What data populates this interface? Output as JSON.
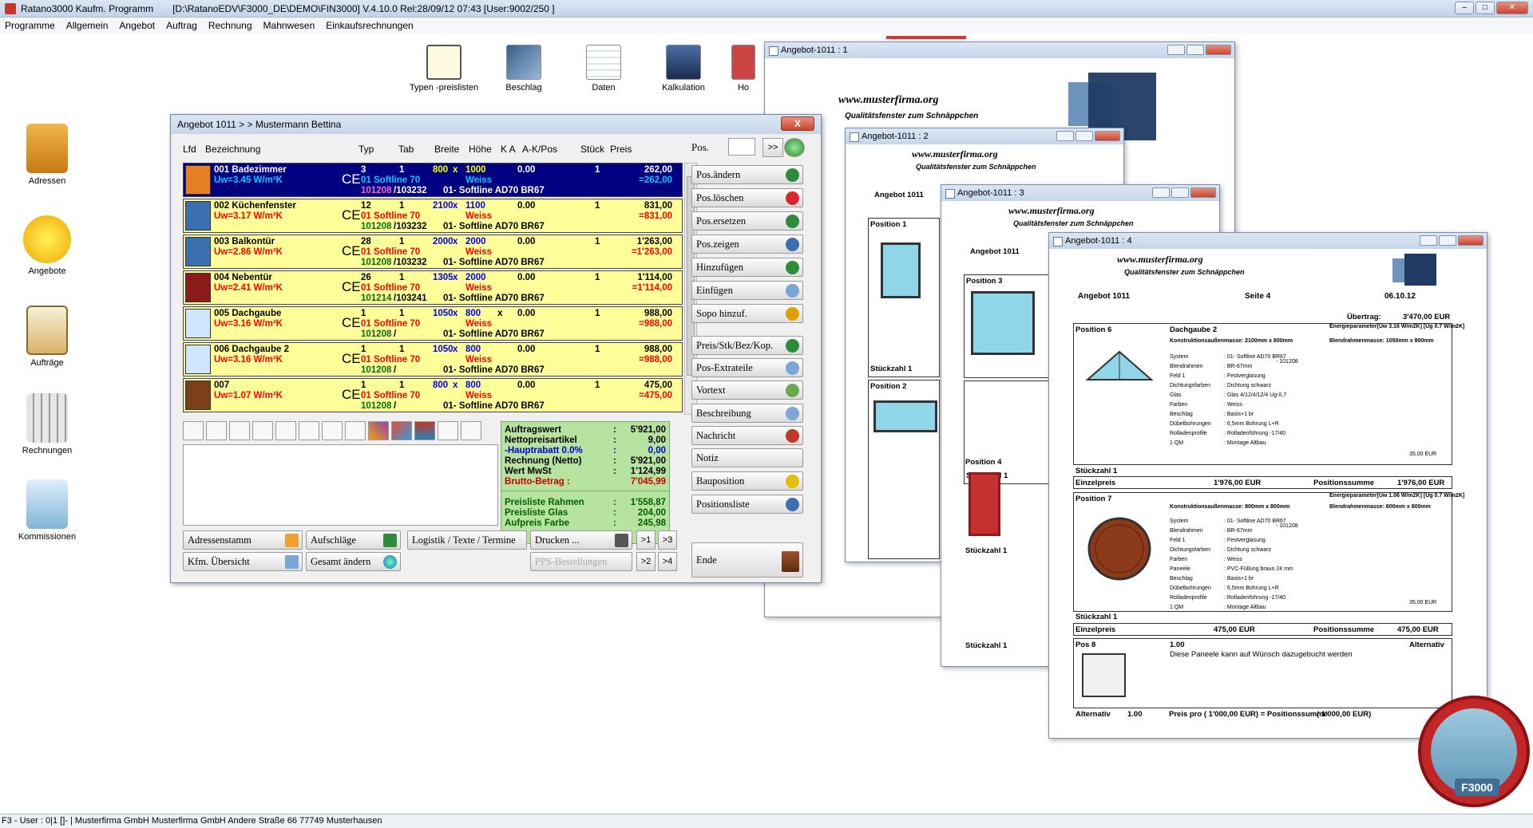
{
  "app": {
    "title": "Ratano3000 Kaufm. Programm",
    "path": "[D:\\RatanoEDV\\F3000_DE\\DEMO\\FIN3000] V.4.10.0 Rel:28/09/12 07:43 [User:9002/250 ]",
    "win_min": "–",
    "win_max": "□",
    "win_close": "✕"
  },
  "menu": [
    "Programme",
    "Allgemein",
    "Angebot",
    "Auftrag",
    "Rechnung",
    "Mahnwesen",
    "Einkaufsrechnungen"
  ],
  "toolbar": [
    "Typen -preislisten",
    "Beschlag",
    "Daten",
    "Kalkulation",
    "Ho"
  ],
  "sidebar": [
    "Adressen",
    "Angebote",
    "Aufträge",
    "Rechnungen",
    "Kommissionen"
  ],
  "dialog": {
    "title": "Angebot 1011 >  > Mustermann Bettina",
    "close": "X",
    "headers": {
      "lfd": "Lfd",
      "bez": "Bezeichnung",
      "typ": "Typ",
      "tab": "Tab",
      "breite": "Breite",
      "hoehe": "Höhe",
      "ka": "K A",
      "akpos": "A-K/Pos",
      "stueck": "Stück",
      "preis": "Preis"
    },
    "pos_label": "Pos.",
    "pos_nav": ">>",
    "rows": [
      {
        "name": "001 Badezimmer",
        "uw": "Uw=3.45 W/m²K",
        "typ": "3",
        "tab": "1",
        "b": "800",
        "x": "x",
        "h": "1000",
        "ak": "0.00",
        "st": "1",
        "p1": "262,00",
        "p2": "=262,00",
        "typname": "01 Softline 70",
        "farbe": "Weiss",
        "code": "101208",
        "code2": "/103232",
        "profil": "01- Softline AD70 BR67",
        "ce": "CE"
      },
      {
        "name": "002 Küchenfenster",
        "uw": "Uw=3.17 W/m²K",
        "typ": "12",
        "tab": "1",
        "b": "2100",
        "x": "x",
        "h": "1100",
        "ak": "0.00",
        "st": "1",
        "p1": "831,00",
        "p2": "=831,00",
        "typname": "01 Softline 70",
        "farbe": "Weiss",
        "code": "101208",
        "code2": "/103232",
        "profil": "01- Softline AD70 BR67",
        "ce": "CE"
      },
      {
        "name": "003 Balkontür",
        "uw": "Uw=2.86 W/m²K",
        "typ": "28",
        "tab": "1",
        "b": "2000",
        "x": "x",
        "h": "2000",
        "ak": "0.00",
        "st": "1",
        "p1": "1'263,00",
        "p2": "=1'263,00",
        "typname": "01 Softline 70",
        "farbe": "Weiss",
        "code": "101208",
        "code2": "/103232",
        "profil": "01- Softline AD70 BR67",
        "ce": "CE"
      },
      {
        "name": "004 Nebentür",
        "uw": "Uw=2.41 W/m²K",
        "typ": "26",
        "tab": "1",
        "b": "1305",
        "x": "x",
        "h": "2000",
        "ak": "0.00",
        "st": "1",
        "p1": "1'114,00",
        "p2": "=1'114,00",
        "typname": "01 Softline 70",
        "farbe": "Weiss",
        "code": "101214",
        "code2": "/103241",
        "profil": "01- Softline AD70 BR67",
        "ce": "CE"
      },
      {
        "name": "005 Dachgaube",
        "uw": "Uw=3.16 W/m²K",
        "typ": "1",
        "tab": "1",
        "b": "1050",
        "x": "x",
        "h": "800",
        "ak": "0.00",
        "st": "1",
        "p1": "988,00",
        "p2": "=988,00",
        "typname": "01 Softline 70",
        "farbe": "Weiss",
        "code": "101208",
        "code2": "/",
        "profil": "01- Softline AD70 BR67",
        "ce": "CE",
        "xmark": "x"
      },
      {
        "name": "006 Dachgaube 2",
        "uw": "Uw=3.16 W/m²K",
        "typ": "1",
        "tab": "1",
        "b": "1050",
        "x": "x",
        "h": "800",
        "ak": "0.00",
        "st": "1",
        "p1": "988,00",
        "p2": "=988,00",
        "typname": "01 Softline 70",
        "farbe": "Weiss",
        "code": "101208",
        "code2": "/",
        "profil": "01- Softline AD70 BR67",
        "ce": "CE"
      },
      {
        "name": "007",
        "uw": "Uw=1.07 W/m²K",
        "typ": "1",
        "tab": "1",
        "b": "800",
        "x": "x",
        "h": "800",
        "ak": "0.00",
        "st": "1",
        "p1": "475,00",
        "p2": "=475,00",
        "typname": "01 Softline 70",
        "farbe": "Weiss",
        "code": "101208",
        "code2": "/",
        "profil": "01- Softline AD70 BR67",
        "ce": "CE"
      }
    ],
    "right_buttons": [
      "Pos.ändern",
      "Pos.löschen",
      "Pos.ersetzen",
      "Pos.zeigen",
      "Hinzufügen",
      "Einfügen",
      "Sopo hinzuf.",
      "Preis/Stk/Bez/Kop.",
      "Pos-Extrateile",
      "Vortext",
      "Beschreibung",
      "Nachricht",
      "Notiz",
      "Bauposition",
      "Positionsliste"
    ],
    "ende": "Ende",
    "summary": [
      {
        "l": "Auftragswert",
        "c": ":",
        "v": "5'921,00",
        "color": "#000000"
      },
      {
        "l": "Nettopreisartikel",
        "c": ":",
        "v": "9,00",
        "color": "#000000"
      },
      {
        "l": "-Hauptrabatt 0.0%",
        "c": ":",
        "v": "0,00",
        "color": "#0000cc"
      },
      {
        "l": "Rechnung (Netto)",
        "c": ":",
        "v": "5'921,00",
        "color": "#000000"
      },
      {
        "l": "Wert MwSt",
        "c": ":",
        "v": "1'124,99",
        "color": "#000000"
      },
      {
        "l": "Brutto-Betrag :",
        "c": "",
        "v": "7'045,99",
        "color": "#cc0000"
      },
      {
        "l": "Preisliste Rahmen",
        "c": ":",
        "v": "1'558,87",
        "color": "#006000"
      },
      {
        "l": "Preisliste Glas",
        "c": ":",
        "v": "204,00",
        "color": "#006000"
      },
      {
        "l": "Aufpreis Farbe",
        "c": ":",
        "v": "245,98",
        "color": "#006000"
      }
    ],
    "bottom": {
      "adressenstamm": "Adressenstamm",
      "aufschlaege": "Aufschläge",
      "logistik": "Logistik / Texte / Termine",
      "drucken": "Drucken ...",
      "kfm": "Kfm. Übersicht",
      "gesamt": "Gesamt ändern",
      "pps": "PPS-Bestellungen",
      "n1": ">1",
      "n3": ">3",
      "n2": ">2",
      "n4": ">4"
    }
  },
  "docs": {
    "d1": {
      "title": "Angebot-1011 : 1"
    },
    "d2": {
      "title": "Angebot-1011 : 2",
      "angebot": "Angebot 1011",
      "pos1": "Position 1",
      "stk1": "Stückzahl  1",
      "pos2": "Position 2"
    },
    "d3": {
      "title": "Angebot-1011 : 3",
      "angebot": "Angebot 1011",
      "pos3": "Position 3",
      "stk3": "Stückzahl  1",
      "pos4": "Position 4",
      "stk4": "Stückzahl  1",
      "stk_end": "Stückzahl  1"
    },
    "d4": {
      "title": "Angebot-1011 : 4",
      "angebot": "Angebot 1011",
      "seite": "Seite 4",
      "datum": "06.10.12",
      "uebertrag_l": "Übertrag:",
      "uebertrag_v": "3'470,00 EUR",
      "p6": "Position 6",
      "p6name": "Dachgaube 2",
      "energie": "Energieparameter[Uw 3.16 W/m2K] [Ug 0.7 W/m2K]",
      "konstr6": "Konstruktionsaußenmasse: 2100mm x 800mm",
      "blend6": "Blendrahmenmasse: 1050mm x 800mm",
      "stk6": "Stückzahl   1",
      "einzel6_l": "Einzelpreis",
      "einzel6_v": "1'976,00   EUR",
      "sum6_l": "Positionssumme",
      "sum6_v": "1'976,00   EUR",
      "p7": "Position 7",
      "energie7": "Energieparameter[Uw 1.06 W/m2K] [Ug 0.7 W/m2K]",
      "konstr7": "Konstruktionsaußenmasse: 800mm x 800mm",
      "blend7": "Blendrahmenmasse: 800mm x 800mm",
      "stk7": "Stückzahl   1",
      "einzel7_l": "Einzelpreis",
      "einzel7_v": "475,00   EUR",
      "sum7_l": "Positionssumme",
      "sum7_v": "475,00   EUR",
      "p8": "Pos 8",
      "p8qty": "1.00",
      "p8text": "Diese Paneele kann auf Wünsch dazugebucht werden",
      "alternativ": "Alternativ",
      "alt_l": "Alternativ",
      "alt_qty": "1.00",
      "preis_pro": "Preis pro  (     1'000,00 EUR) =   Positionssumme",
      "preis_alt": "(     1'000,00 EUR)",
      "spec_labels": [
        "System",
        "Blendrahmen",
        "Feld 1",
        "Dichtungsfarben",
        "Glas",
        "Farben",
        "Beschlag",
        "Dübelbohrungen",
        "Rolladenprofile",
        "1 QM"
      ],
      "spec_values": [
        ": 01- Softline AD70 BR67",
        ": BR-67mm",
        ": Festverglasung",
        ": Dichtung schwarz",
        ": Glas 4/12/4/12/4 Ug-0,7",
        ": Weiss",
        ": Basis+1 br",
        ": 6,5mm Bohrung L+R",
        ": Rolladenführung -17/40",
        ": Montage Altbau"
      ],
      "spec_code": "- 101208",
      "spec_amount": "35,00 EUR",
      "spec7_labels": [
        "System",
        "Blendrahmen",
        "Feld 1",
        "Dichtungsfarben",
        "Farben",
        "Paneele",
        "Beschlag",
        "Dübelbohrungen",
        "Rolladenprofile",
        "1 QM"
      ],
      "spec7_values": [
        ": 01- Softline AD70 BR67",
        ": BR-67mm",
        ": Festverglasung",
        ": Dichtung schwarz",
        ": Weiss",
        ": PVC-Füllung braun 24 mm",
        ": Basis+1 br",
        ": 6,5mm Bohrung L+R",
        ": Rolladenführung -17/40",
        ": Montage Altbau"
      ]
    },
    "website": "www.musterfirma.org",
    "slogan": "Qualitätsfenster zum Schnäppchen"
  },
  "badge": "F3000",
  "status": "F3 - User : 0|1 []- | Musterfirma GmbH    Musterfirma GmbH Andere Straße 66  77749 Musterhausen"
}
